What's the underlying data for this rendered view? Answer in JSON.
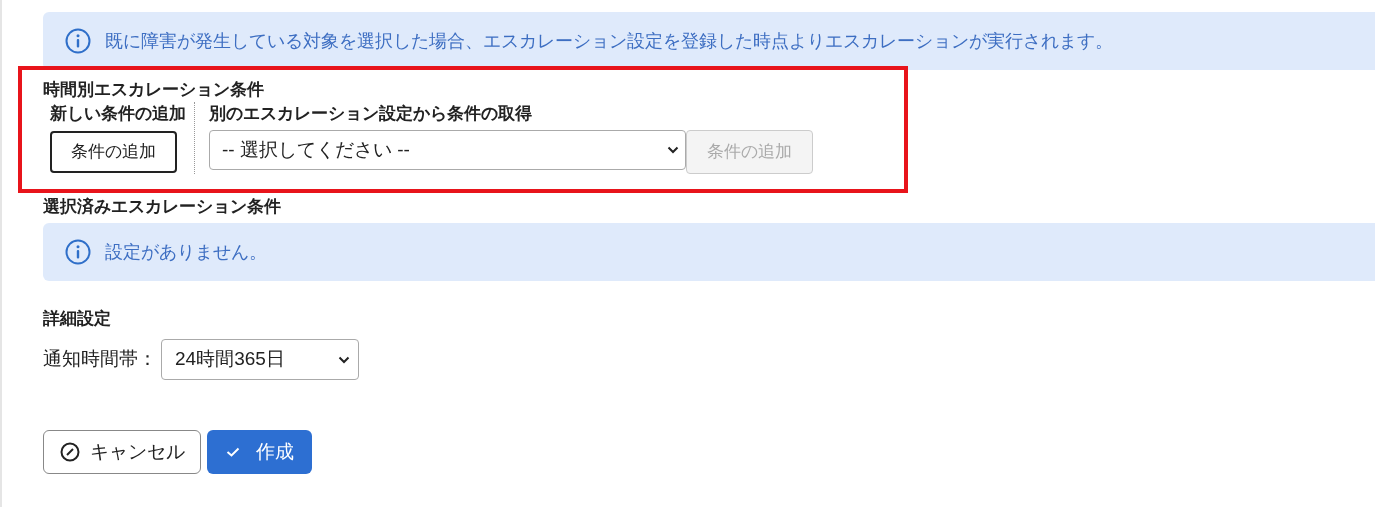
{
  "notice": {
    "text": "既に障害が発生している対象を選択した場合、エスカレーション設定を登録した時点よりエスカレーションが実行されます。"
  },
  "time_conditions": {
    "title": "時間別エスカレーション条件",
    "new_condition": {
      "label": "新しい条件の追加",
      "button": {
        "label": "条件の追加",
        "disabled": false
      }
    },
    "copy_from": {
      "label": "別のエスカレーション設定から条件の取得",
      "select": {
        "value": "-- 選択してください --"
      },
      "button": {
        "label": "条件の追加",
        "disabled": true
      }
    }
  },
  "selected_conditions": {
    "title": "選択済みエスカレーション条件",
    "notice": "設定がありません。"
  },
  "details": {
    "title": "詳細設定",
    "label": "通知時間帯：",
    "select": {
      "value": "24時間365日"
    }
  },
  "buttons": [
    {
      "kind": "cancel",
      "label": "キャンセル"
    },
    {
      "kind": "submit",
      "label": "作成"
    }
  ]
}
